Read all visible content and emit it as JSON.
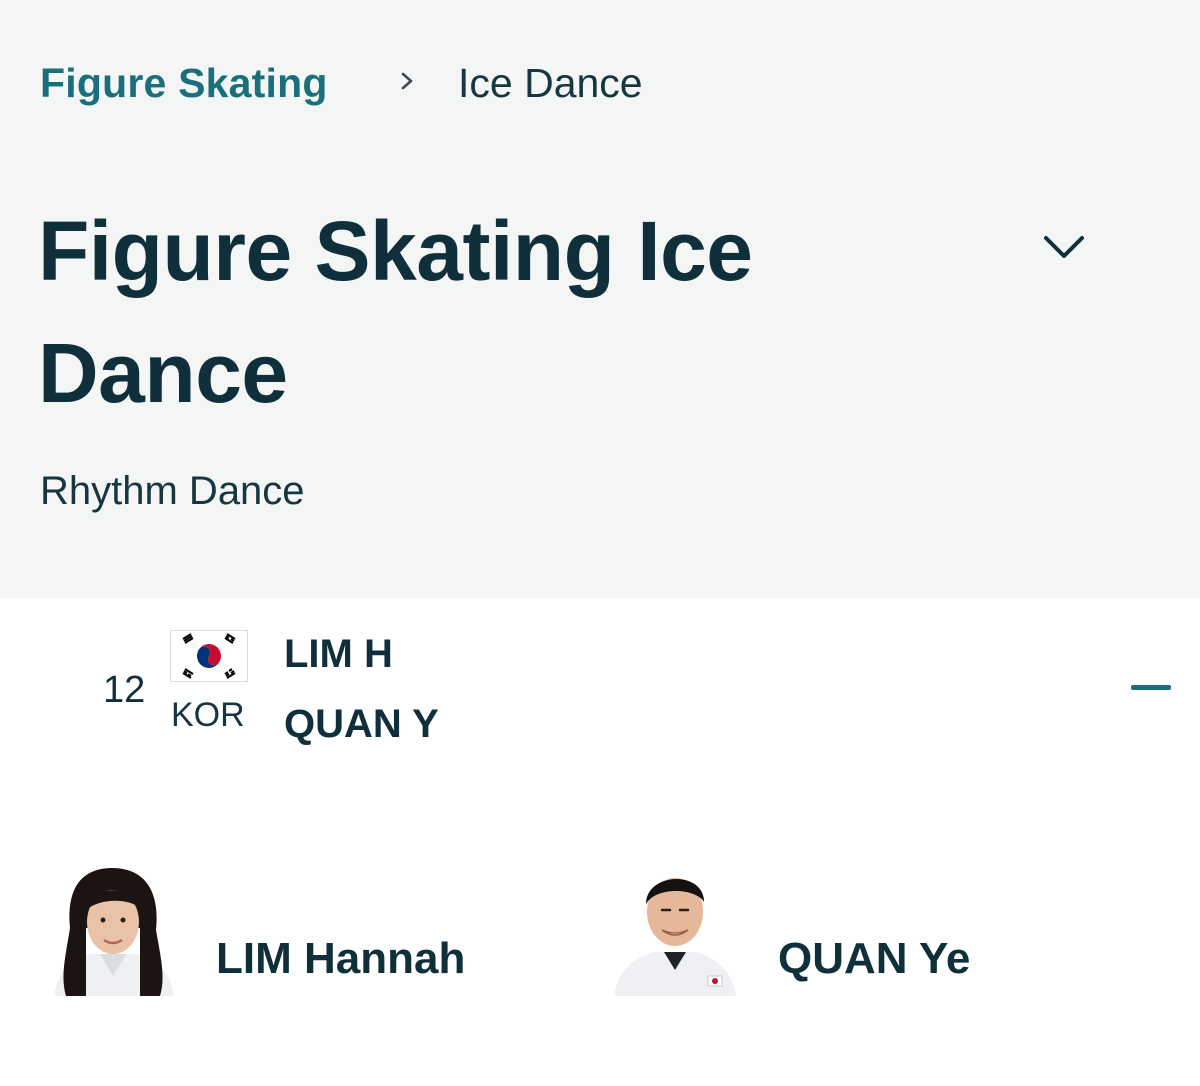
{
  "breadcrumb": {
    "parent": "Figure Skating",
    "separator_icon": "chevron-right-icon",
    "current": "Ice Dance"
  },
  "page": {
    "title": "Figure Skating Ice Dance",
    "dropdown_icon": "chevron-down-icon",
    "subtitle": "Rhythm Dance"
  },
  "entry": {
    "rank": "12",
    "noc": "KOR",
    "flag_icon": "south-korea-flag-icon",
    "athletes_short": [
      "LIM H",
      "QUAN Y"
    ],
    "collapse_icon": "minus-icon"
  },
  "athletes": [
    {
      "name": "LIM Hannah"
    },
    {
      "name": "QUAN Ye"
    }
  ],
  "colors": {
    "header_bg": "#f4f5f5",
    "accent": "#1a6f7c",
    "text_dark": "#0f2f3a",
    "page_bg": "#ffffff"
  }
}
